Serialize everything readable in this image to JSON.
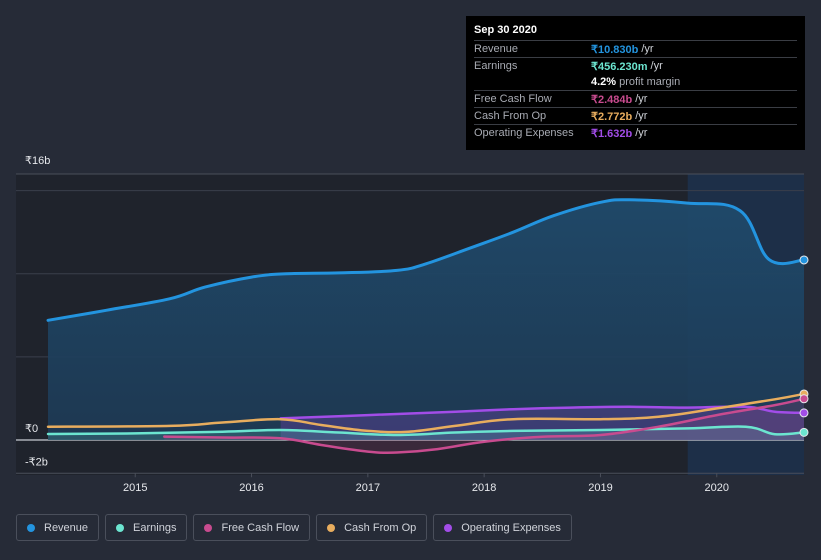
{
  "tooltip": {
    "date": "Sep 30 2020",
    "rows": [
      {
        "label": "Revenue",
        "value": "₹10.830b",
        "unit": "/yr",
        "color": "#2394df"
      },
      {
        "label": "Earnings",
        "value": "₹456.230m",
        "unit": "/yr",
        "color": "#6ce5d0"
      },
      {
        "label": "Free Cash Flow",
        "value": "₹2.484b",
        "unit": "/yr",
        "color": "#c84b8f"
      },
      {
        "label": "Cash From Op",
        "value": "₹2.772b",
        "unit": "/yr",
        "color": "#e8ad5e"
      },
      {
        "label": "Operating Expenses",
        "value": "₹1.632b",
        "unit": "/yr",
        "color": "#a24de8"
      }
    ],
    "profit_margin_value": "4.2%",
    "profit_margin_text": "profit margin"
  },
  "legend": [
    {
      "label": "Revenue",
      "color": "#2394df"
    },
    {
      "label": "Earnings",
      "color": "#6ce5d0"
    },
    {
      "label": "Free Cash Flow",
      "color": "#c84b8f"
    },
    {
      "label": "Cash From Op",
      "color": "#e8ad5e"
    },
    {
      "label": "Operating Expenses",
      "color": "#a24de8"
    }
  ],
  "chart_data": {
    "type": "area",
    "title": "",
    "xlabel": "",
    "ylabel": "",
    "x_ticks": [
      "2015",
      "2016",
      "2017",
      "2018",
      "2019",
      "2020"
    ],
    "y_ticks": [
      {
        "value": 16,
        "label": "₹16b"
      },
      {
        "value": 0,
        "label": "₹0"
      },
      {
        "value": -2,
        "label": "-₹2b"
      }
    ],
    "gridlines_b": [
      15,
      10,
      5
    ],
    "ylim": [
      -2,
      16
    ],
    "xlim": [
      2014.25,
      2020.75
    ],
    "highlight_from": 2019.75,
    "legend_position": "bottom",
    "units": "₹ billions",
    "series": [
      {
        "name": "Revenue",
        "color": "#2394df",
        "filled": true,
        "points": [
          [
            2014.25,
            7.2
          ],
          [
            2014.75,
            7.8
          ],
          [
            2015.3,
            8.5
          ],
          [
            2015.6,
            9.2
          ],
          [
            2016.0,
            9.8
          ],
          [
            2016.3,
            10.0
          ],
          [
            2016.75,
            10.05
          ],
          [
            2017.25,
            10.2
          ],
          [
            2017.5,
            10.6
          ],
          [
            2017.9,
            11.6
          ],
          [
            2018.25,
            12.5
          ],
          [
            2018.6,
            13.5
          ],
          [
            2019.0,
            14.3
          ],
          [
            2019.25,
            14.45
          ],
          [
            2019.75,
            14.25
          ],
          [
            2020.2,
            13.8
          ],
          [
            2020.45,
            10.85
          ],
          [
            2020.75,
            10.83
          ]
        ]
      },
      {
        "name": "Earnings",
        "color": "#6ce5d0",
        "filled": true,
        "points": [
          [
            2014.25,
            0.36
          ],
          [
            2015.0,
            0.4
          ],
          [
            2015.75,
            0.5
          ],
          [
            2016.25,
            0.6
          ],
          [
            2016.75,
            0.45
          ],
          [
            2017.25,
            0.3
          ],
          [
            2017.75,
            0.45
          ],
          [
            2018.25,
            0.55
          ],
          [
            2019.0,
            0.6
          ],
          [
            2019.75,
            0.7
          ],
          [
            2020.25,
            0.8
          ],
          [
            2020.5,
            0.35
          ],
          [
            2020.75,
            0.46
          ]
        ]
      },
      {
        "name": "Free Cash Flow",
        "color": "#c84b8f",
        "filled": true,
        "points": [
          [
            2015.25,
            0.2
          ],
          [
            2015.75,
            0.15
          ],
          [
            2016.25,
            0.1
          ],
          [
            2016.6,
            -0.3
          ],
          [
            2017.0,
            -0.7
          ],
          [
            2017.25,
            -0.75
          ],
          [
            2017.6,
            -0.55
          ],
          [
            2018.0,
            -0.1
          ],
          [
            2018.5,
            0.2
          ],
          [
            2019.0,
            0.3
          ],
          [
            2019.5,
            0.8
          ],
          [
            2020.0,
            1.5
          ],
          [
            2020.5,
            2.1
          ],
          [
            2020.75,
            2.48
          ]
        ]
      },
      {
        "name": "Cash From Op",
        "color": "#e8ad5e",
        "filled": false,
        "points": [
          [
            2014.25,
            0.8
          ],
          [
            2015.3,
            0.85
          ],
          [
            2015.75,
            1.05
          ],
          [
            2016.25,
            1.25
          ],
          [
            2016.6,
            0.9
          ],
          [
            2017.0,
            0.55
          ],
          [
            2017.35,
            0.5
          ],
          [
            2017.75,
            0.85
          ],
          [
            2018.25,
            1.25
          ],
          [
            2019.0,
            1.25
          ],
          [
            2019.5,
            1.4
          ],
          [
            2020.0,
            1.9
          ],
          [
            2020.5,
            2.45
          ],
          [
            2020.75,
            2.77
          ]
        ]
      },
      {
        "name": "Operating Expenses",
        "color": "#a24de8",
        "filled": true,
        "points": [
          [
            2016.25,
            1.3
          ],
          [
            2017.0,
            1.5
          ],
          [
            2017.75,
            1.7
          ],
          [
            2018.25,
            1.85
          ],
          [
            2018.75,
            1.95
          ],
          [
            2019.25,
            2.0
          ],
          [
            2019.75,
            1.95
          ],
          [
            2020.25,
            2.0
          ],
          [
            2020.5,
            1.7
          ],
          [
            2020.75,
            1.63
          ]
        ]
      }
    ]
  }
}
